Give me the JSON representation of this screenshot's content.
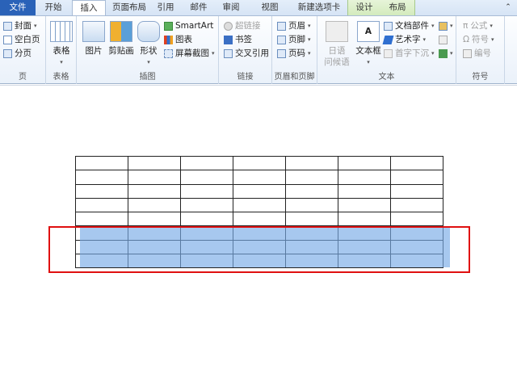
{
  "tabs": [
    "文件",
    "开始",
    "插入",
    "页面布局",
    "引用",
    "邮件",
    "审阅",
    "视图",
    "新建选项卡",
    "设计",
    "布局"
  ],
  "active_tab": "插入",
  "groups": {
    "page": {
      "label": "页",
      "items": [
        "封面",
        "空白页",
        "分页"
      ]
    },
    "table": {
      "label": "表格",
      "items": [
        "表格"
      ]
    },
    "illustrations": {
      "label": "插图",
      "items": [
        "图片",
        "剪贴画",
        "形状",
        "SmartArt",
        "图表",
        "屏幕截图"
      ]
    },
    "links": {
      "label": "链接",
      "items": [
        "超链接",
        "书签",
        "交叉引用"
      ]
    },
    "header_footer": {
      "label": "页眉和页脚",
      "items": [
        "页眉",
        "页脚",
        "页码"
      ]
    },
    "text": {
      "label": "文本",
      "items": [
        "日语",
        "问候语",
        "文本框",
        "文档部件",
        "艺术字",
        "首字下沉"
      ]
    },
    "symbols": {
      "label": "符号",
      "items": [
        "公式",
        "符号",
        "编号"
      ]
    }
  },
  "table": {
    "rows": 8,
    "cols": 7,
    "selected_rows": [
      6,
      7,
      8
    ]
  },
  "colors": {
    "file_tab": "#2a62b8",
    "selection": "#a6c8ee",
    "highlight_box": "#e01010"
  }
}
